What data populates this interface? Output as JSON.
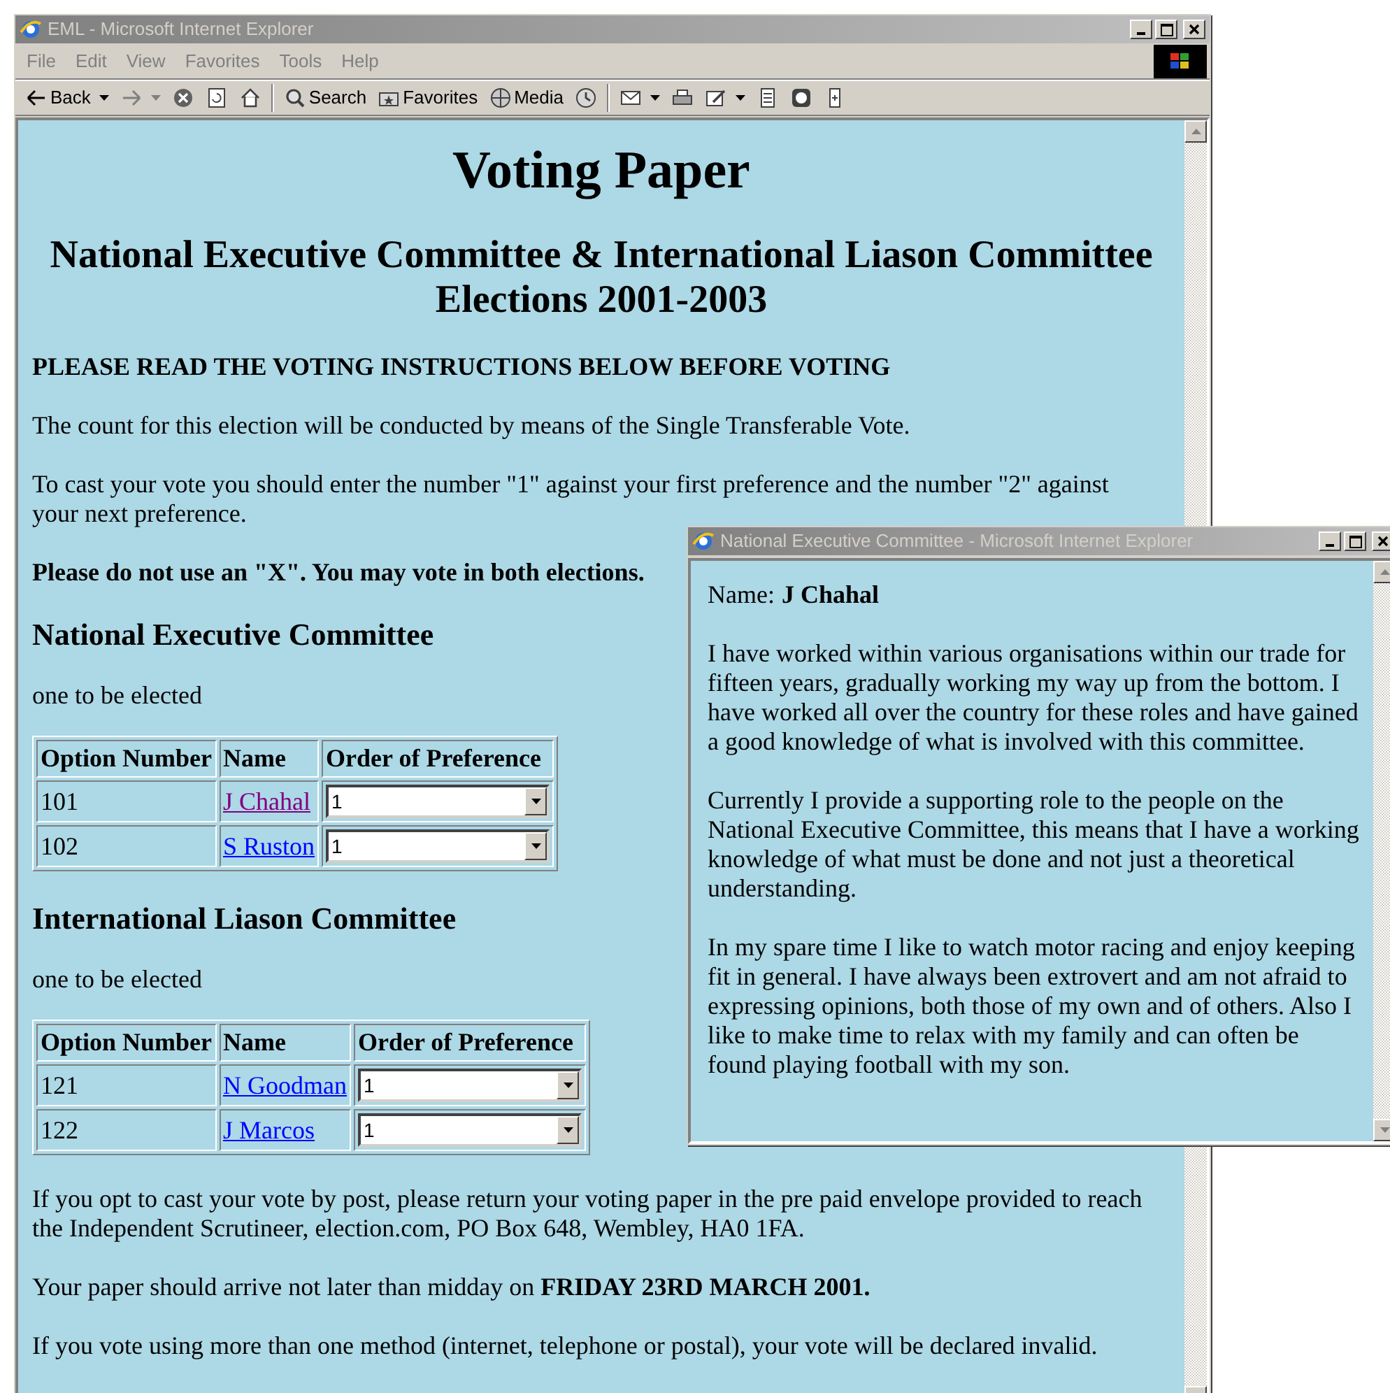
{
  "main_window": {
    "title": "EML - Microsoft Internet Explorer",
    "menu": [
      "File",
      "Edit",
      "View",
      "Favorites",
      "Tools",
      "Help"
    ],
    "toolbar": [
      {
        "kind": "back",
        "label": "Back"
      },
      {
        "kind": "forward"
      },
      {
        "kind": "stop"
      },
      {
        "kind": "refresh"
      },
      {
        "kind": "home"
      },
      {
        "kind": "separator"
      },
      {
        "kind": "search",
        "label": "Search"
      },
      {
        "kind": "favorites",
        "label": "Favorites"
      },
      {
        "kind": "media",
        "label": "Media"
      },
      {
        "kind": "history"
      },
      {
        "kind": "separator"
      },
      {
        "kind": "mail"
      },
      {
        "kind": "print"
      },
      {
        "kind": "edit"
      },
      {
        "kind": "discuss"
      },
      {
        "kind": "messenger"
      },
      {
        "kind": "note"
      }
    ],
    "page": {
      "heading": "Voting Paper",
      "subheading": "National Executive Committee & International Liason Committee Elections 2001-2003",
      "intro": [
        {
          "text": "PLEASE READ THE VOTING INSTRUCTIONS BELOW BEFORE VOTING",
          "bold": true
        },
        {
          "text": "The count for this election will be conducted by means of the Single Transferable Vote.",
          "bold": false
        },
        {
          "text": "To cast your vote you should enter the number \"1\" against your first preference and the number \"2\" against your next preference.",
          "bold": false
        },
        {
          "text": "Please do not use an \"X\". You may vote in both elections.",
          "bold": true
        }
      ],
      "elections": [
        {
          "title": "National Executive Committee",
          "note": "one to be elected",
          "columns": [
            "Option Number",
            "Name",
            "Order of Preference"
          ],
          "rows": [
            {
              "option": "101",
              "name": "J Chahal",
              "visited": true,
              "preference": "1"
            },
            {
              "option": "102",
              "name": "S Ruston",
              "visited": false,
              "preference": "1"
            }
          ]
        },
        {
          "title": "International Liason Committee",
          "note": "one to be elected",
          "columns": [
            "Option Number",
            "Name",
            "Order of Preference"
          ],
          "rows": [
            {
              "option": "121",
              "name": "N Goodman",
              "visited": false,
              "preference": "1"
            },
            {
              "option": "122",
              "name": "J Marcos",
              "visited": false,
              "preference": "1"
            }
          ]
        }
      ],
      "footer": [
        "If you opt to cast your vote by post, please return your voting paper in the pre paid envelope provided to reach the Independent Scrutineer, election.com, PO Box 648, Wembley, HA0 1FA.",
        "Your paper should arrive not later than midday on **FRIDAY 23RD MARCH 2001.**",
        "If you vote using more than one method (internet, telephone or postal), your vote will be declared invalid."
      ]
    }
  },
  "popup_window": {
    "title": "National Executive Committee - Microsoft Internet Explorer",
    "name_label": "Name:",
    "name": "J Chahal",
    "paragraphs": [
      "I have worked within various organisations within our trade for fifteen years, gradually working my way up from the bottom. I have worked all over the country for these roles and have gained a good knowledge of what is involved with this committee.",
      "Currently I provide a supporting role to the people on the National Executive Committee, this means that I have a working knowledge of what must be done and not just a theoretical understanding.",
      "In my spare time I like to watch motor racing and enjoy keeping fit in general. I have always been extrovert and am not afraid to expressing opinions, both those of my own and of others. Also I like to make time to relax with my family and can often be found playing football with my son."
    ]
  }
}
